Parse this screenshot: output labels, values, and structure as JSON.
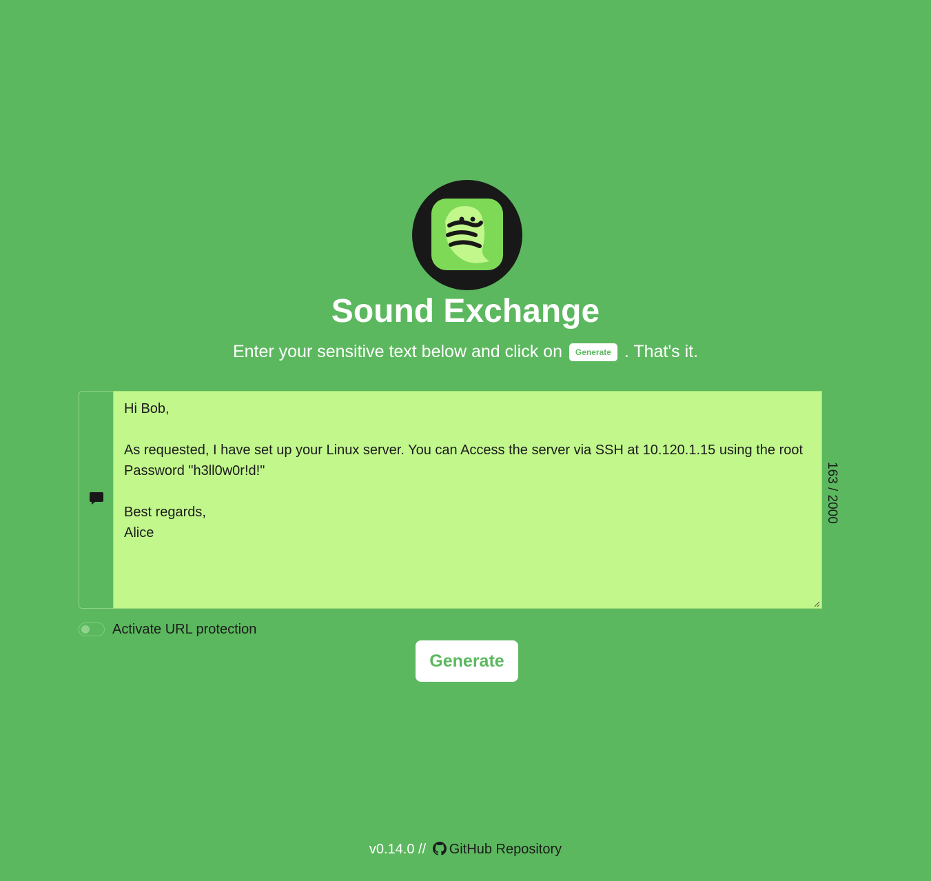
{
  "app": {
    "title": "Sound Exchange",
    "subtitle_before": "Enter your sensitive text below and click on",
    "subtitle_pill": "Generate",
    "subtitle_after": ". That's it."
  },
  "logo": {
    "icon": "snake-logo-icon",
    "colors": {
      "ring": "#181818",
      "tile": "#7ed957",
      "snake": "#c2f78c"
    }
  },
  "editor": {
    "icon": "comment-icon",
    "message": "Hi Bob,\n\nAs requested, I have set up your Linux server. You can Access the server via SSH at 10.120.1.15 using the root Password \"h3ll0w0r!d!\"\n\nBest regards,\nAlice",
    "counter": "163 / 2000"
  },
  "protection": {
    "label": "Activate URL protection",
    "enabled": false
  },
  "generate_button": {
    "label": "Generate"
  },
  "footer": {
    "version": "v0.14.0",
    "separator": "//",
    "link_icon": "github-icon",
    "link_label": "GitHub Repository"
  },
  "colors": {
    "background": "#5cb85f",
    "textarea": "#c2f78c",
    "button_text": "#5cb85f",
    "text": "#1b1b1b"
  }
}
